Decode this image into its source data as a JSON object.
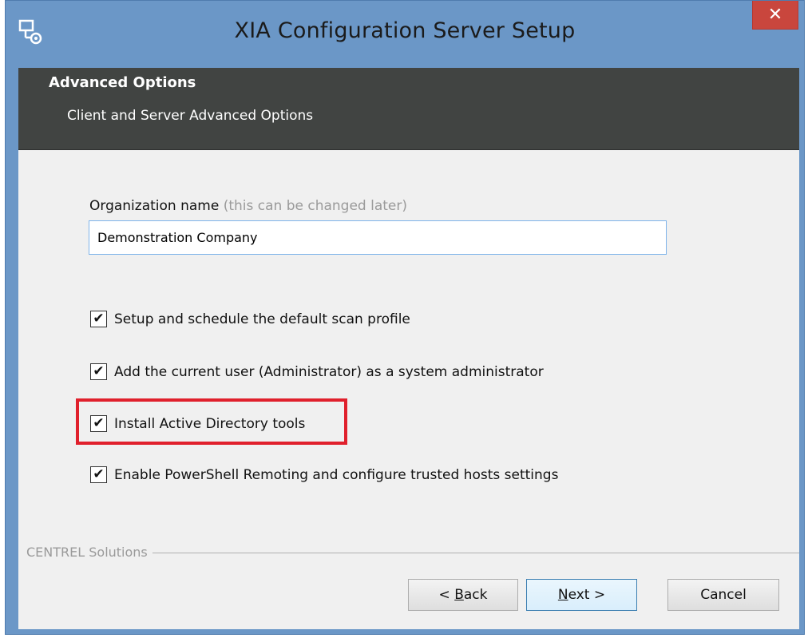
{
  "window": {
    "title": "XIA Configuration Server Setup",
    "close_glyph": "✕",
    "accent": "#6b97c7"
  },
  "banner": {
    "title": "Advanced Options",
    "subtitle": "Client and Server Advanced Options"
  },
  "form": {
    "org_label": "Organization name",
    "org_hint": "(this can be changed later)",
    "org_value": "Demonstration Company"
  },
  "options": [
    {
      "label": "Setup and schedule the default scan profile",
      "checked": true
    },
    {
      "label": "Add the current user (Administrator) as a system administrator",
      "checked": true
    },
    {
      "label": "Install Active Directory tools",
      "checked": true
    },
    {
      "label": "Enable PowerShell Remoting and configure trusted hosts settings",
      "checked": true
    }
  ],
  "checkmark": "✔",
  "highlight_color": "#e0202c",
  "footer": {
    "brand": "CENTREL Solutions"
  },
  "buttons": {
    "back": {
      "prefix": "< ",
      "accel": "B",
      "rest": "ack"
    },
    "next": {
      "accel": "N",
      "rest": "ext >"
    },
    "cancel": "Cancel"
  }
}
